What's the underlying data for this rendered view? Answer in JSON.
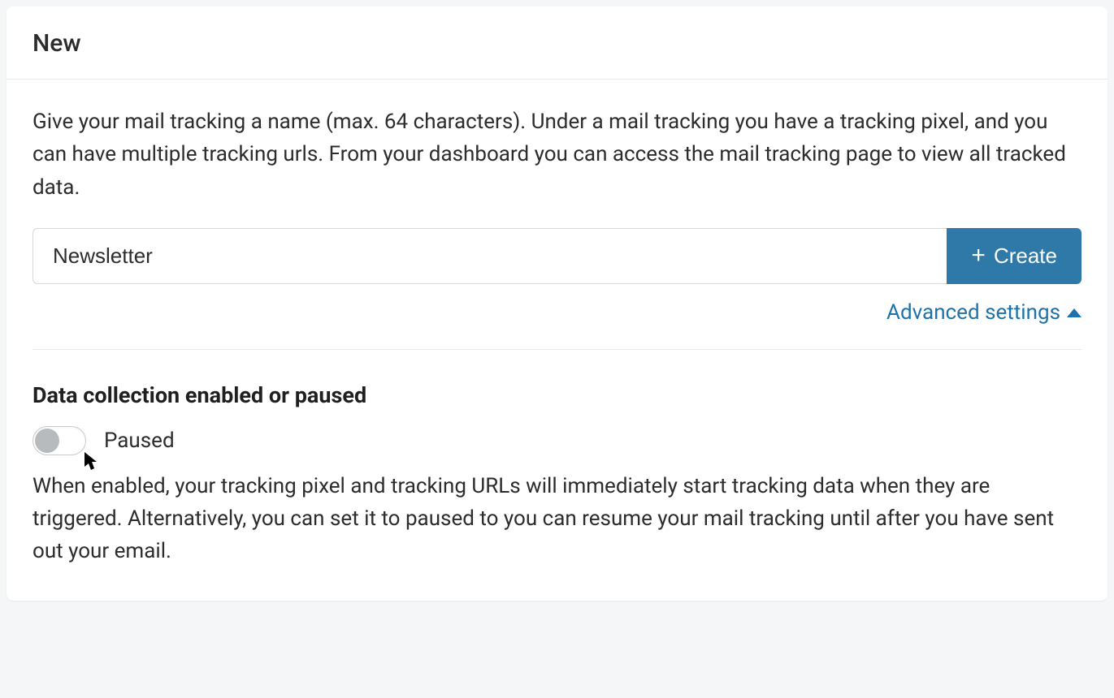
{
  "header": {
    "title": "New"
  },
  "description": "Give your mail tracking a name (max. 64 characters). Under a mail tracking you have a tracking pixel, and you can have multiple tracking urls. From your dashboard you can access the mail tracking page to view all tracked data.",
  "input": {
    "value": "Newsletter"
  },
  "createButton": {
    "label": "Create"
  },
  "advanced": {
    "label": "Advanced settings"
  },
  "dataCollection": {
    "heading": "Data collection enabled or paused",
    "toggleState": "Paused",
    "description": "When enabled, your tracking pixel and tracking URLs will immediately start tracking data when they are triggered. Alternatively, you can set it to paused to you can resume your mail tracking until after you have sent out your email."
  }
}
